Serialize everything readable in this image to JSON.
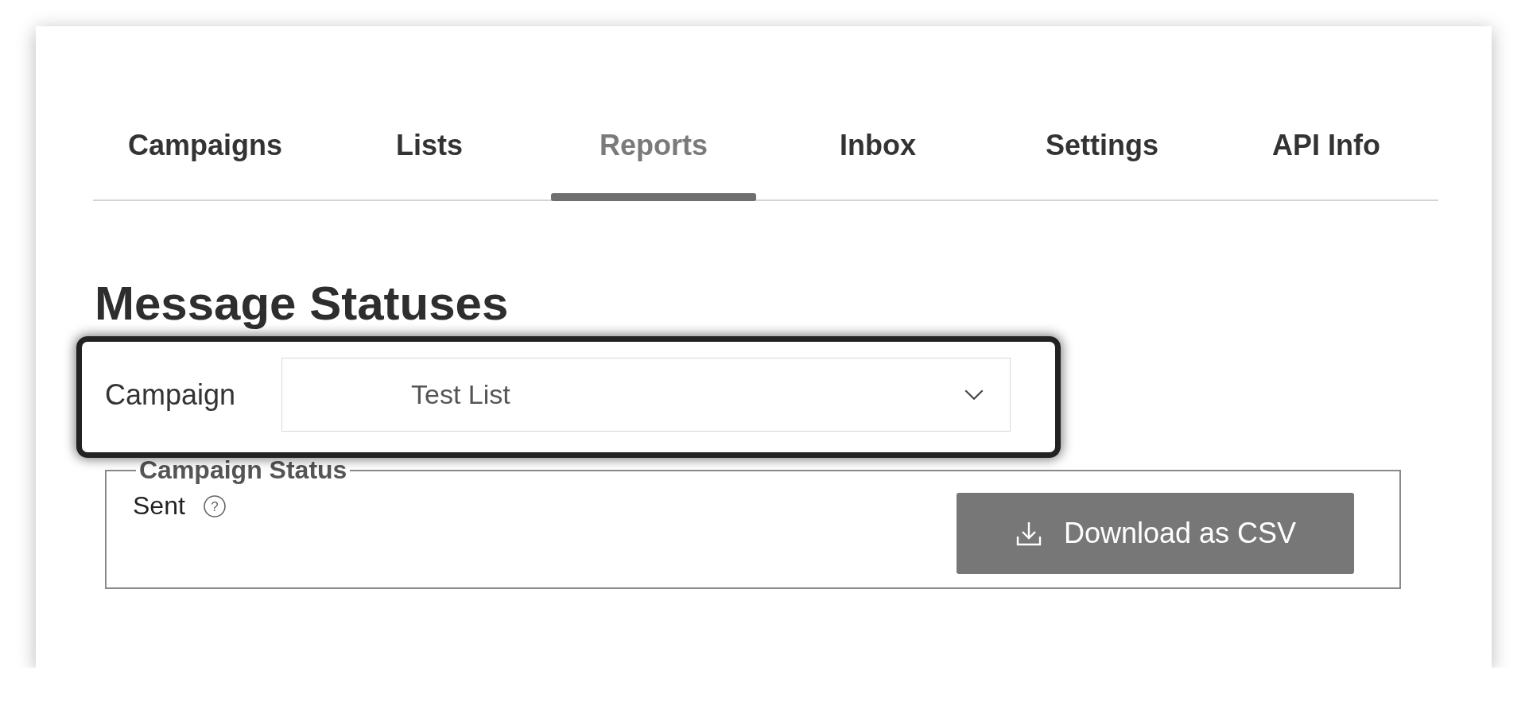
{
  "tabs": [
    {
      "label": "Campaigns",
      "selected": false
    },
    {
      "label": "Lists",
      "selected": false
    },
    {
      "label": "Reports",
      "selected": true
    },
    {
      "label": "Inbox",
      "selected": false
    },
    {
      "label": "Settings",
      "selected": false
    },
    {
      "label": "API Info",
      "selected": false
    }
  ],
  "heading": "Message Statuses",
  "campaign_filter": {
    "label": "Campaign",
    "value": "Test List",
    "highlighted": true
  },
  "campaign_status": {
    "title": "Campaign Status",
    "status": "Sent",
    "help_glyph": "?",
    "button": "Download as CSV"
  }
}
